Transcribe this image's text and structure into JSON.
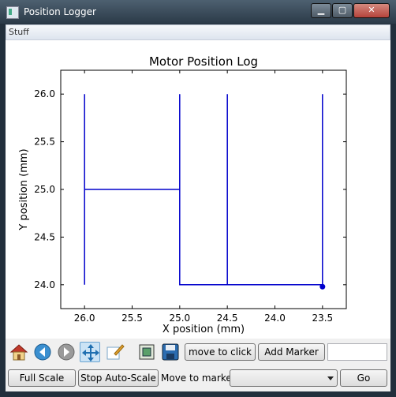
{
  "window": {
    "title": "Position Logger",
    "min_glyph": "▁",
    "max_glyph": "▢",
    "close_glyph": "✕"
  },
  "menu": {
    "items": [
      "Stuff"
    ]
  },
  "chart_data": {
    "type": "line",
    "title": "Motor Position Log",
    "xlabel": "X position (mm)",
    "ylabel": "Y position (mm)",
    "xlim": [
      26.25,
      23.25
    ],
    "ylim": [
      23.75,
      26.25
    ],
    "x_ticks": [
      "26.0",
      "25.5",
      "25.0",
      "24.5",
      "24.0",
      "23.5"
    ],
    "y_ticks": [
      "26.0",
      "25.5",
      "25.0",
      "24.5",
      "24.0"
    ],
    "line_color": "#0000cc",
    "series": [
      {
        "x": [
          26.0,
          26.0,
          26.0,
          25.0,
          25.0,
          25.0,
          24.5,
          24.5,
          24.5,
          23.5,
          23.5,
          23.5
        ],
        "y": [
          24.0,
          26.0,
          25.0,
          25.0,
          26.0,
          24.0,
          24.0,
          26.0,
          24.0,
          24.0,
          26.0,
          24.0
        ]
      }
    ],
    "marker": {
      "x": 23.5,
      "y": 23.98
    }
  },
  "toolbar": {
    "icons": [
      "home-icon",
      "back-icon",
      "forward-icon",
      "pan-icon",
      "zoom-icon",
      "subplots-icon",
      "save-icon"
    ],
    "move_to_click_label": "move to click",
    "add_marker_label": "Add Marker",
    "marker_name_value": ""
  },
  "bottom": {
    "full_scale_label": "Full Scale",
    "stop_autoscale_label": "Stop Auto-Scale",
    "move_to_marker_label": "Move to marker:",
    "marker_select_value": "",
    "go_label": "Go"
  }
}
